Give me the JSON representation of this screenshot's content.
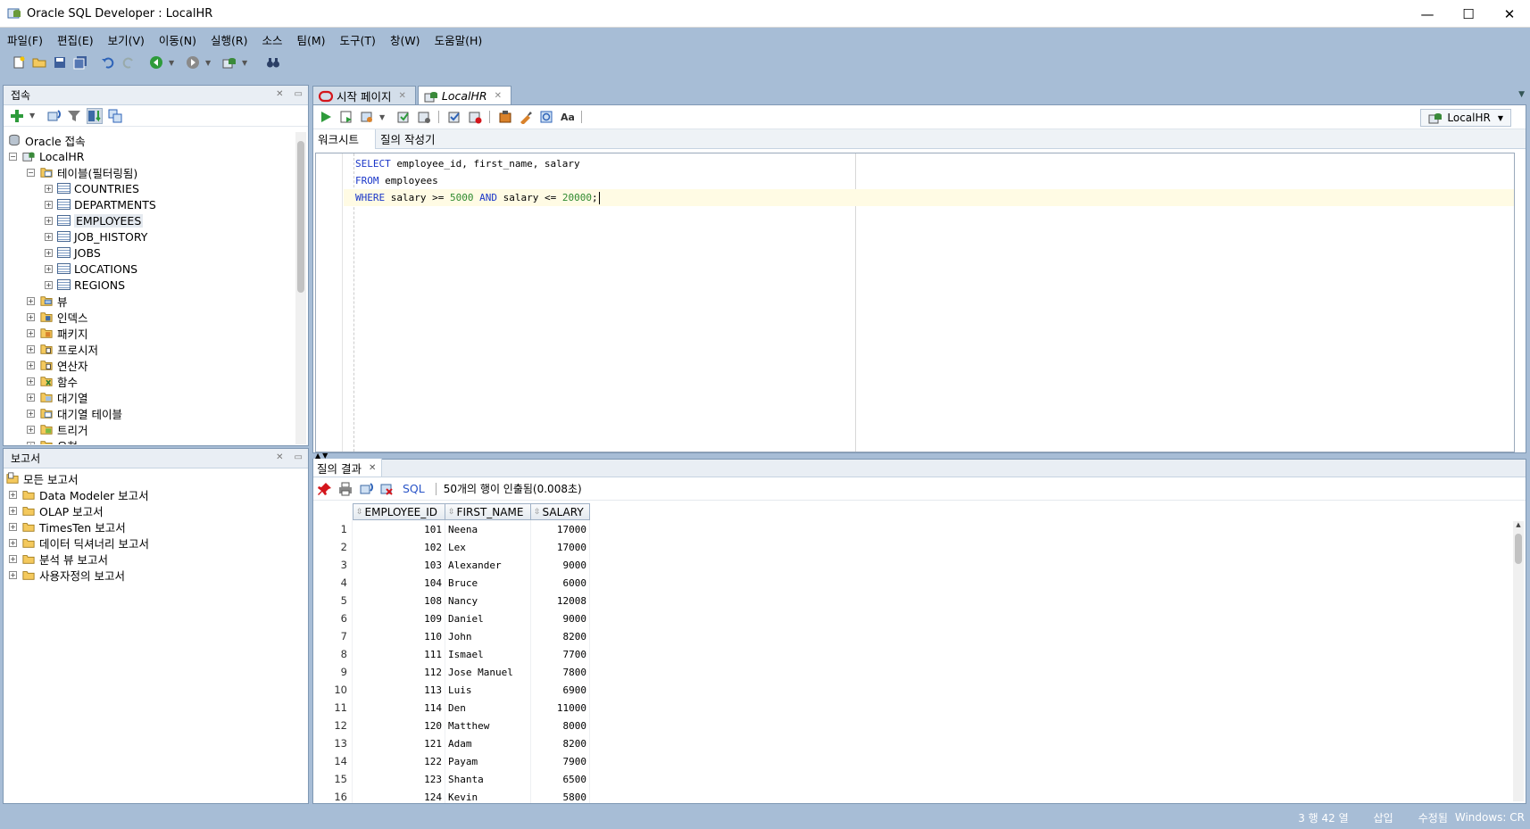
{
  "window": {
    "title": "Oracle SQL Developer : LocalHR"
  },
  "menu": [
    "파일(F)",
    "편집(E)",
    "보기(V)",
    "이동(N)",
    "실행(R)",
    "소스",
    "팀(M)",
    "도구(T)",
    "창(W)",
    "도움말(H)"
  ],
  "connections_panel": {
    "title": "접속",
    "root": "Oracle 접속",
    "connection": "LocalHR",
    "tables_node": "테이블(필터링됨)",
    "tables": [
      "COUNTRIES",
      "DEPARTMENTS",
      "EMPLOYEES",
      "JOB_HISTORY",
      "JOBS",
      "LOCATIONS",
      "REGIONS"
    ],
    "other_nodes": [
      "뷰",
      "인덱스",
      "패키지",
      "프로시저",
      "연산자",
      "함수",
      "대기열",
      "대기열 테이블",
      "트리거",
      "유형"
    ]
  },
  "reports_panel": {
    "title": "보고서",
    "root": "모든 보고서",
    "items": [
      "Data Modeler 보고서",
      "OLAP 보고서",
      "TimesTen 보고서",
      "데이터 딕셔너리 보고서",
      "분석 뷰 보고서",
      "사용자정의 보고서"
    ]
  },
  "doc_tabs": [
    {
      "label": "시작 페이지"
    },
    {
      "label": "LocalHR"
    }
  ],
  "editor": {
    "connection_selector": "LocalHR",
    "sub_tabs": [
      "워크시트",
      "질의 작성기"
    ],
    "sql": {
      "line1": {
        "k1": "SELECT",
        "r1": " employee_id, first_name, salary"
      },
      "line2": {
        "k1": "FROM",
        "r1": " employees"
      },
      "line3": {
        "k1": "WHERE",
        "r1": " salary >= ",
        "n1": "5000",
        "k2": " AND",
        "r2": " salary <= ",
        "n2": "20000",
        "r3": ";"
      }
    }
  },
  "results": {
    "tab_label": "질의 결과",
    "sql_link": "SQL",
    "status": "50개의 행이 인출됨(0.008초)",
    "columns": [
      "EMPLOYEE_ID",
      "FIRST_NAME",
      "SALARY"
    ],
    "rows": [
      [
        "1",
        "101",
        "Neena",
        "17000"
      ],
      [
        "2",
        "102",
        "Lex",
        "17000"
      ],
      [
        "3",
        "103",
        "Alexander",
        "9000"
      ],
      [
        "4",
        "104",
        "Bruce",
        "6000"
      ],
      [
        "5",
        "108",
        "Nancy",
        "12008"
      ],
      [
        "6",
        "109",
        "Daniel",
        "9000"
      ],
      [
        "7",
        "110",
        "John",
        "8200"
      ],
      [
        "8",
        "111",
        "Ismael",
        "7700"
      ],
      [
        "9",
        "112",
        "Jose Manuel",
        "7800"
      ],
      [
        "10",
        "113",
        "Luis",
        "6900"
      ],
      [
        "11",
        "114",
        "Den",
        "11000"
      ],
      [
        "12",
        "120",
        "Matthew",
        "8000"
      ],
      [
        "13",
        "121",
        "Adam",
        "8200"
      ],
      [
        "14",
        "122",
        "Payam",
        "7900"
      ],
      [
        "15",
        "123",
        "Shanta",
        "6500"
      ],
      [
        "16",
        "124",
        "Kevin",
        "5800"
      ]
    ]
  },
  "statusbar": {
    "position": "3 행 42 열",
    "mode": "삽입",
    "modified": "수정됨",
    "eol": "Windows: CR"
  }
}
